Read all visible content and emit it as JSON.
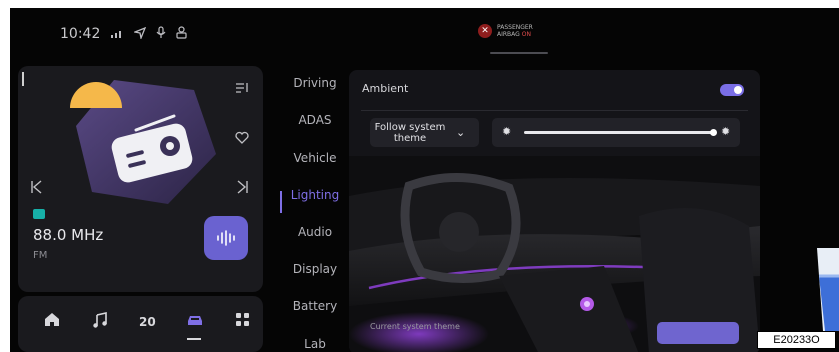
{
  "status_bar": {
    "time": "10:42",
    "icons": [
      "signal-icon",
      "navigation-icon",
      "microphone-icon",
      "profile-icon"
    ]
  },
  "airbag": {
    "line1": "PASSENGER",
    "line2": "AIRBAG",
    "state": "ON"
  },
  "media": {
    "frequency": "88.0 MHz",
    "band": "FM",
    "icons": [
      "radio-icon",
      "playlist-icon",
      "favorite-heart-icon",
      "previous-track-icon",
      "next-track-icon",
      "fm-badge-icon",
      "equalizer-icon"
    ]
  },
  "dock": {
    "temperature": "20",
    "icons": [
      "home-icon",
      "music-icon",
      "climate-icon",
      "car-icon",
      "apps-icon"
    ],
    "active": "car-icon"
  },
  "settings_menu": {
    "items": [
      "Driving",
      "ADAS",
      "Vehicle",
      "Lighting",
      "Audio",
      "Display",
      "Battery",
      "Lab"
    ],
    "active": "Lighting"
  },
  "lighting_panel": {
    "ambient_label": "Ambient",
    "ambient_enabled": true,
    "theme_select": "Follow system theme",
    "brightness_level": 0.98,
    "caption": "Current system theme"
  },
  "colors": {
    "accent": "#7f6fe6",
    "button": "#6f65cf",
    "panel": "#141418",
    "ambient_light": "#8a3fd0",
    "radio_tile": "#6a62d0"
  },
  "watermark": "E20233O"
}
